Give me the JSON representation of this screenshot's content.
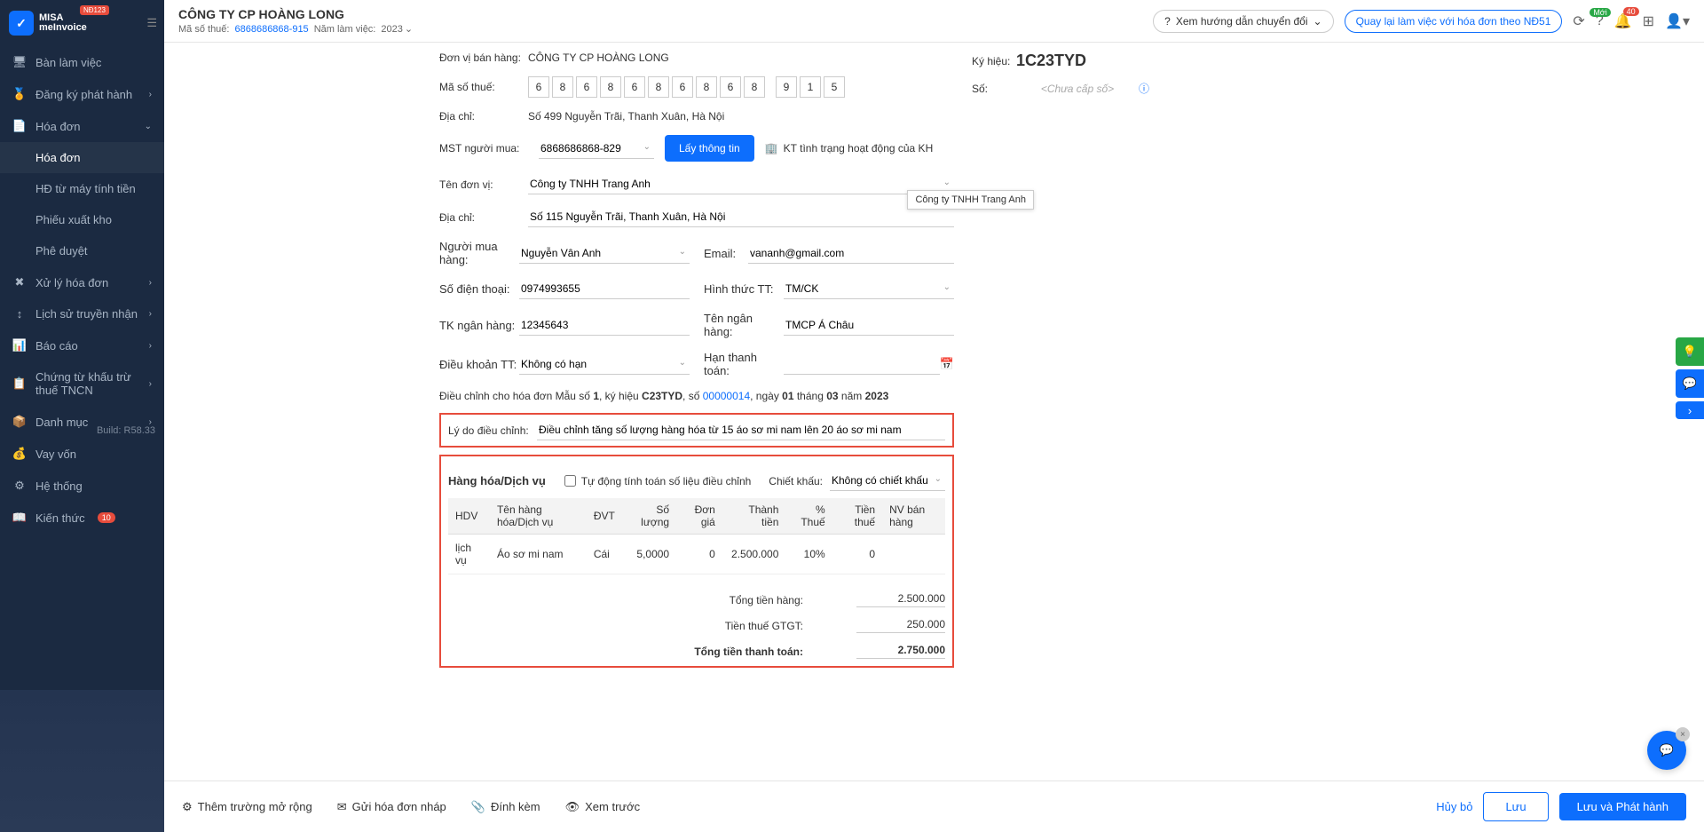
{
  "logo": {
    "t1": "MISA",
    "t2": "meInvoice",
    "badge": "NĐ123"
  },
  "header": {
    "company": "CÔNG TY CP HOÀNG LONG",
    "mst_label": "Mã số thuế:",
    "mst": "6868686868-915",
    "year_label": "Năm làm việc:",
    "year": "2023",
    "guide": "Xem hướng dẫn chuyển đổi",
    "back": "Quay lại làm việc với hóa đơn theo NĐ51",
    "badge_new": "Mới",
    "badge_bell": "40"
  },
  "nav": {
    "items": [
      {
        "icon": "🖥",
        "label": "Bàn làm việc",
        "chev": ""
      },
      {
        "icon": "🏅",
        "label": "Đăng ký phát hành",
        "chev": "›"
      },
      {
        "icon": "📄",
        "label": "Hóa đơn",
        "chev": "⌄",
        "expanded": true,
        "children": [
          {
            "label": "Hóa đơn",
            "selected": true
          },
          {
            "label": "HĐ từ máy tính tiền"
          },
          {
            "label": "Phiếu xuất kho"
          },
          {
            "label": "Phê duyệt"
          }
        ]
      },
      {
        "icon": "✖",
        "label": "Xử lý hóa đơn",
        "chev": "›"
      },
      {
        "icon": "↕",
        "label": "Lịch sử truyền nhận",
        "chev": "›"
      },
      {
        "icon": "📊",
        "label": "Báo cáo",
        "chev": "›"
      },
      {
        "icon": "📋",
        "label": "Chứng từ khấu trừ thuế TNCN",
        "chev": "›"
      },
      {
        "icon": "📦",
        "label": "Danh mục",
        "chev": "›"
      },
      {
        "icon": "💰",
        "label": "Vay vốn",
        "chev": ""
      },
      {
        "icon": "⚙",
        "label": "Hệ thống",
        "chev": "",
        "build": "Build: R58.33"
      },
      {
        "icon": "📖",
        "label": "Kiến thức",
        "chev": "",
        "badge": "10"
      }
    ]
  },
  "form": {
    "donvi_label": "Đơn vị bán hàng:",
    "donvi": "CÔNG TY CP HOÀNG LONG",
    "mst_label": "Mã số thuế:",
    "mst_digits": [
      "6",
      "8",
      "6",
      "8",
      "6",
      "8",
      "6",
      "8",
      "6",
      "8",
      "",
      "9",
      "1",
      "5"
    ],
    "diachi_label": "Địa chỉ:",
    "diachi": "Số 499 Nguyễn Trãi, Thanh Xuân, Hà Nội",
    "mst_buyer_label": "MST người mua:",
    "mst_buyer": "6868686868-829",
    "lay_thong_tin": "Lấy thông tin",
    "kt_tinh_trang": "KT tình trạng hoạt động của KH",
    "ten_donvi_label": "Tên đơn vị:",
    "ten_donvi": "Công ty TNHH Trang Anh",
    "tooltip": "Công ty TNHH Trang Anh",
    "diachi2_label": "Địa chỉ:",
    "diachi2": "Số 115 Nguyễn Trãi, Thanh Xuân, Hà Nội",
    "nguoi_mua_label": "Người mua hàng:",
    "nguoi_mua": "Nguyễn Vân Anh",
    "email_label": "Email:",
    "email": "vananh@gmail.com",
    "sdt_label": "Số điện thoại:",
    "sdt": "0974993655",
    "hinhthuc_label": "Hình thức TT:",
    "hinhthuc": "TM/CK",
    "tk_label": "TK ngân hàng:",
    "tk": "12345643",
    "ten_nh_label": "Tên ngân hàng:",
    "ten_nh": "TMCP Á Châu",
    "dieukhoan_label": "Điều khoản TT:",
    "dieukhoan": "Không có hạn",
    "han_label": "Hạn thanh toán:",
    "han": "",
    "dieuchinh_text": {
      "pre": "Điều chỉnh cho hóa đơn Mẫu số ",
      "mau": "1",
      "ky": ", ký hiệu ",
      "kyhieu": "C23TYD",
      "so": ", số ",
      "sono": "00000014",
      "ngay": ", ngày ",
      "day": "01",
      "thang": " tháng ",
      "month": "03",
      "nam": " năm ",
      "year": "2023"
    },
    "lydo_label": "Lý do điều chỉnh:",
    "lydo": "Điều chỉnh tăng số lượng hàng hóa từ 15 áo sơ mi nam lên 20 áo sơ mi nam"
  },
  "side": {
    "kyhieu_label": "Ký hiệu:",
    "kyhieu": "1C23TYD",
    "so_label": "Số:",
    "so_placeholder": "<Chưa cấp số>"
  },
  "table": {
    "title": "Hàng hóa/Dịch vụ",
    "auto_calc": "Tự động tính toán số liệu điều chỉnh",
    "chietkhau_label": "Chiết khấu:",
    "chietkhau": "Không có chiết khấu",
    "cols": [
      "HDV",
      "Tên hàng hóa/Dịch vụ",
      "ĐVT",
      "Số lượng",
      "Đơn giá",
      "Thành tiền",
      "% Thuế",
      "Tiền thuế",
      "NV bán hàng"
    ],
    "rows": [
      {
        "hdv": "lịch vụ",
        "ten": "Áo sơ mi nam",
        "dvt": "Cái",
        "sl": "5,0000",
        "dg": "0",
        "tt": "2.500.000",
        "thue": "10%",
        "tienthue": "0",
        "nv": ""
      }
    ],
    "totals": {
      "tong_tien_label": "Tổng tiền hàng:",
      "tong_tien": "2.500.000",
      "tien_thue_label": "Tiền thuế GTGT:",
      "tien_thue": "250.000",
      "tong_tt_label": "Tổng tiền thanh toán:",
      "tong_tt": "2.750.000"
    }
  },
  "footer": {
    "them_truong": "Thêm trường mở rộng",
    "gui": "Gửi hóa đơn nháp",
    "dinh_kem": "Đính kèm",
    "xem_truoc": "Xem trước",
    "huy": "Hủy bỏ",
    "luu": "Lưu",
    "luu_phat": "Lưu và Phát hành"
  }
}
